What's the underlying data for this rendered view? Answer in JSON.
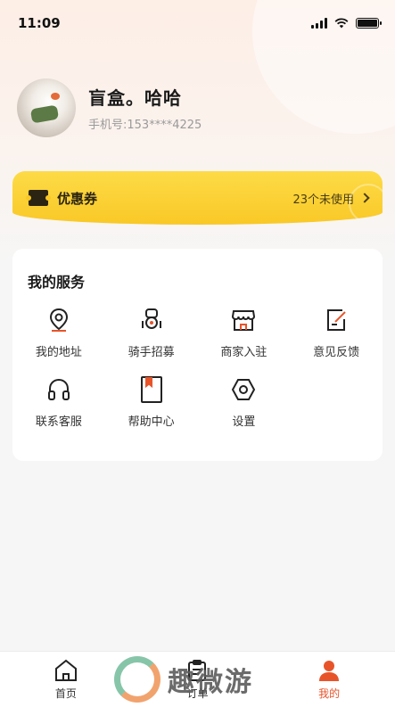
{
  "status_bar": {
    "time": "11:09"
  },
  "profile": {
    "name": "盲盒。哈哈",
    "phone": "手机号:153****4225"
  },
  "coupon": {
    "title": "优惠券",
    "status": "23个未使用"
  },
  "services": {
    "title": "我的服务",
    "items": [
      {
        "label": "我的地址",
        "icon": "location-pin-icon"
      },
      {
        "label": "骑手招募",
        "icon": "rider-icon"
      },
      {
        "label": "商家入驻",
        "icon": "store-icon"
      },
      {
        "label": "意见反馈",
        "icon": "feedback-icon"
      },
      {
        "label": "联系客服",
        "icon": "headset-icon"
      },
      {
        "label": "帮助中心",
        "icon": "help-book-icon"
      },
      {
        "label": "设置",
        "icon": "settings-hex-icon"
      }
    ]
  },
  "tabbar": {
    "items": [
      {
        "label": "首页",
        "icon": "home-icon"
      },
      {
        "label": "订单",
        "icon": "order-clipboard-icon"
      },
      {
        "label": "我的",
        "icon": "user-icon",
        "active": true
      }
    ]
  },
  "watermark": {
    "text": "趣微游"
  },
  "colors": {
    "accent": "#e8542a",
    "coupon_yellow": "#f9c826"
  }
}
